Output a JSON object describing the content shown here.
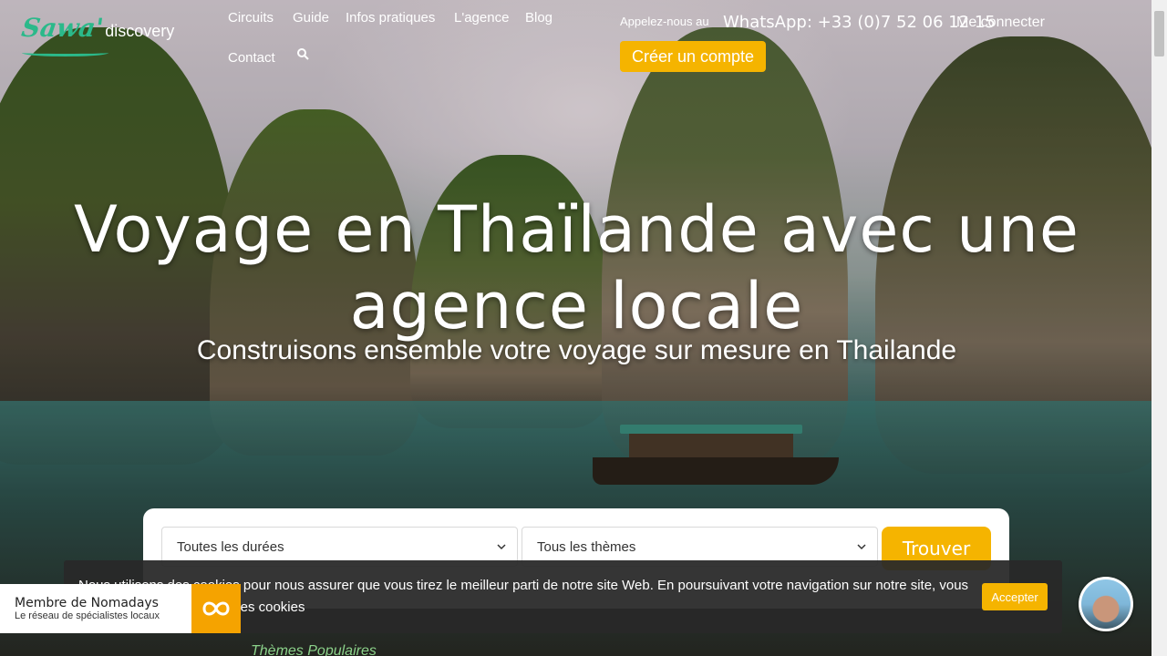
{
  "header": {
    "logo_brand": "Sawa'",
    "logo_sub": "discovery",
    "nav": [
      "Circuits",
      "Guide",
      "Infos pratiques",
      "L'agence",
      "Blog",
      "Contact"
    ],
    "call_label": "Appelez-nous au",
    "whatsapp": "WhatsApp: +33 (0)7 52 06 12 15",
    "login": "Me connecter",
    "create_account": "Créer un compte"
  },
  "hero": {
    "title": "Voyage en Thaïlande avec une agence locale",
    "subtitle": "Construisons ensemble votre voyage sur mesure en Thailande"
  },
  "search": {
    "duration": "Toutes les durées",
    "theme": "Tous les thèmes",
    "find": "Trouver"
  },
  "cookie": {
    "text": "Nous utilisons des cookies pour nous assurer que vous tirez le meilleur parti de notre site Web. En poursuivant votre navigation sur notre site, vous acceptez notre utilisation des cookies",
    "accept": "Accepter"
  },
  "nomadays": {
    "title": "Membre de Nomadays",
    "subtitle": "Le réseau de spécialistes locaux"
  },
  "peek_text": "Thèmes Populaires",
  "colors": {
    "accent": "#f5b400",
    "brand": "#2bb98a"
  }
}
